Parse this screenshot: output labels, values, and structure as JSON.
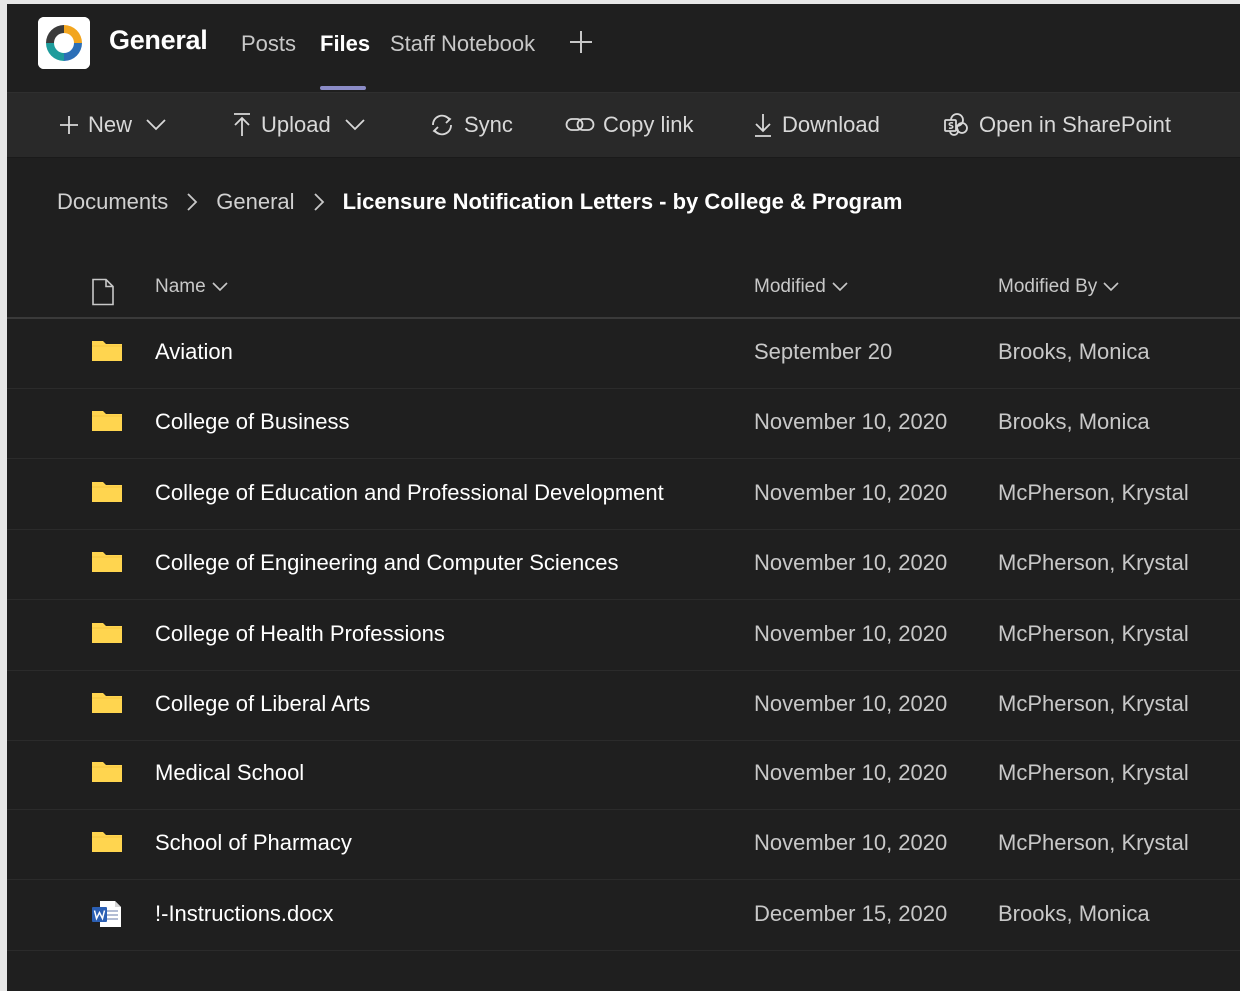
{
  "header": {
    "team_name": "General",
    "tabs": [
      {
        "label": "Posts"
      },
      {
        "label": "Files"
      },
      {
        "label": "Staff Notebook"
      }
    ],
    "active_tab": "Files"
  },
  "toolbar": {
    "new_label": "New",
    "upload_label": "Upload",
    "sync_label": "Sync",
    "copy_link_label": "Copy link",
    "download_label": "Download",
    "open_sharepoint_label": "Open in SharePoint"
  },
  "breadcrumb": {
    "items": [
      "Documents",
      "General",
      "Licensure Notification Letters - by College & Program"
    ]
  },
  "columns": {
    "name": "Name",
    "modified": "Modified",
    "modified_by": "Modified By"
  },
  "files": [
    {
      "type": "folder",
      "name": "Aviation",
      "modified": "September 20",
      "modified_by": "Brooks, Monica"
    },
    {
      "type": "folder",
      "name": "College of Business",
      "modified": "November 10, 2020",
      "modified_by": "Brooks, Monica"
    },
    {
      "type": "folder",
      "name": "College of Education and Professional Development",
      "modified": "November 10, 2020",
      "modified_by": "McPherson, Krystal"
    },
    {
      "type": "folder",
      "name": "College of Engineering and Computer Sciences",
      "modified": "November 10, 2020",
      "modified_by": "McPherson, Krystal"
    },
    {
      "type": "folder",
      "name": "College of Health Professions",
      "modified": "November 10, 2020",
      "modified_by": "McPherson, Krystal"
    },
    {
      "type": "folder",
      "name": "College of Liberal Arts",
      "modified": "November 10, 2020",
      "modified_by": "McPherson, Krystal"
    },
    {
      "type": "folder",
      "name": "Medical School",
      "modified": "November 10, 2020",
      "modified_by": "McPherson, Krystal"
    },
    {
      "type": "folder",
      "name": "School of Pharmacy",
      "modified": "November 10, 2020",
      "modified_by": "McPherson, Krystal"
    },
    {
      "type": "word-doc",
      "name": "!-Instructions.docx",
      "modified": "December 15, 2020",
      "modified_by": "Brooks, Monica"
    }
  ],
  "colors": {
    "background": "#1f1f1f",
    "toolbar": "#292929",
    "accent": "#8b8cc7",
    "folder": "#ffd54f",
    "word": "#2b5fb4"
  }
}
